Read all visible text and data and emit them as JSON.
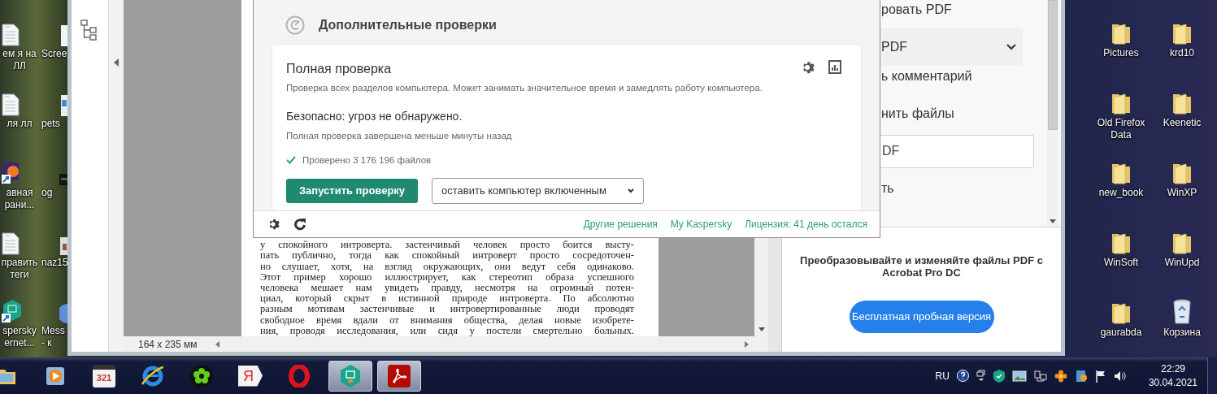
{
  "desktop": {
    "icons_left": [
      {
        "label": "ем я на ЛЛ",
        "kind": "document"
      },
      {
        "label": "ля лл",
        "kind": "document"
      },
      {
        "label": "авная рани...",
        "kind": "browser-shortcut"
      },
      {
        "label": "править теги",
        "kind": "document"
      },
      {
        "label": "spersky ernet...",
        "kind": "shield-shortcut"
      }
    ],
    "icons_second": [
      {
        "label": "Scree",
        "kind": "file"
      },
      {
        "label": "pets",
        "kind": "image"
      },
      {
        "label": "og",
        "kind": "video"
      },
      {
        "label": "naz15",
        "kind": "archive"
      },
      {
        "label": "Mess - к",
        "kind": "app"
      }
    ],
    "icons_right": [
      {
        "label": "Pictures",
        "kind": "folder"
      },
      {
        "label": "krd10",
        "kind": "folder"
      },
      {
        "label": "Old Firefox Data",
        "kind": "folder"
      },
      {
        "label": "Keenetic",
        "kind": "folder"
      },
      {
        "label": "new_book",
        "kind": "folder"
      },
      {
        "label": "WinXP",
        "kind": "folder"
      },
      {
        "label": "WinSoft",
        "kind": "folder"
      },
      {
        "label": "WinUpd",
        "kind": "folder"
      },
      {
        "label": "gaurabda",
        "kind": "folder"
      },
      {
        "label": "Корзина",
        "kind": "trash"
      }
    ]
  },
  "acrobat": {
    "page_lines": [
      "у спокойного интроверта. застенчивый человек просто боится высту-",
      "пать публично, тогда как спокойный интроверт просто сосредоточен-",
      "но слушает, хотя, на взгляд окружающих, они ведут себя одинаково.",
      "Этот пример хорошо иллюстрирует, как стереотип образа успешного",
      "человека мешает нам увидеть правду, несмотря на огромный потен-",
      "циал, который скрыт в истинной природе интроверта. По абсолютно",
      "разным мотивам застенчивые и интровертированные люди проводят",
      "свободное время вдали от внимания общества, делая новые изобрете-",
      "ния, проводя исследования, или сидя у постели смертельно больных."
    ],
    "page_size": "164 x 235 мм",
    "tools": [
      {
        "label": "ровать PDF",
        "kind": "item"
      },
      {
        "label": "PDF",
        "kind": "dropdown"
      },
      {
        "label": "ь комментарий",
        "kind": "item"
      },
      {
        "label": "нить файлы",
        "kind": "item"
      },
      {
        "label": "DF",
        "kind": "field"
      },
      {
        "label": "ть",
        "kind": "item"
      }
    ],
    "promo": {
      "text": "Преобразовывайте и изменяйте файлы PDF с Acrobat Pro DC",
      "button": "Бесплатная пробная версия"
    }
  },
  "kaspersky": {
    "section_title": "Дополнительные проверки",
    "card": {
      "title": "Полная проверка",
      "description": "Проверка всех разделов компьютера. Может занимать значительное время и замедлять работу компьютера.",
      "status": "Безопасно: угроз не обнаружено.",
      "finished": "Полная проверка завершена меньше минуты назад",
      "checked": "Проверено 3 176 196 файлов",
      "run_button": "Запустить проверку",
      "after_scan": "оставить компьютер включенным"
    },
    "footer_links": [
      "Другие решения",
      "My Kaspersky",
      "Лицензия: 41 день остался"
    ]
  },
  "taskbar": {
    "apps": [
      {
        "kind": "explorer",
        "active": false
      },
      {
        "kind": "media-player",
        "active": false
      },
      {
        "kind": "media-classic",
        "active": false,
        "glyph": "321"
      },
      {
        "kind": "ie",
        "active": false
      },
      {
        "kind": "icq",
        "active": false
      },
      {
        "kind": "yandex",
        "active": false,
        "glyph": "Я"
      },
      {
        "kind": "opera",
        "active": false
      },
      {
        "kind": "kaspersky",
        "active": true
      },
      {
        "kind": "acrobat",
        "active": true
      }
    ],
    "language": "RU",
    "time": "22:29",
    "date": "30.04.2021"
  }
}
